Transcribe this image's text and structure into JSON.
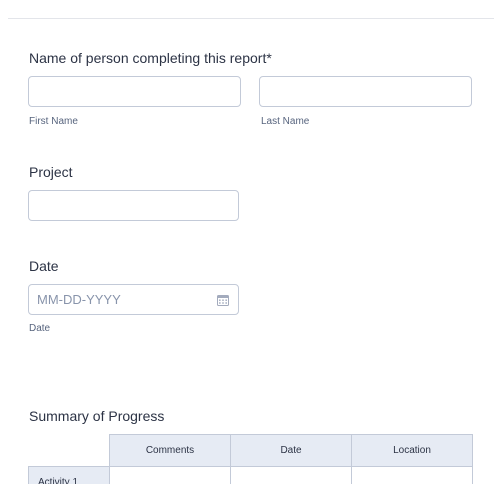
{
  "form": {
    "name_field": {
      "label": "Name of person completing this report*",
      "first_value": "",
      "last_value": "",
      "first_sublabel": "First Name",
      "last_sublabel": "Last Name"
    },
    "project_field": {
      "label": "Project",
      "value": ""
    },
    "date_field": {
      "label": "Date",
      "placeholder": "MM-DD-YYYY",
      "sublabel": "Date",
      "icon": "calendar-icon"
    },
    "summary": {
      "label": "Summary of Progress",
      "columns": [
        "Comments",
        "Date",
        "Location"
      ],
      "rows": [
        "Activity 1"
      ]
    }
  },
  "colors": {
    "border": "#c3cad8",
    "header_bg": "#e6ebf4",
    "text": "#2c3345",
    "sublabel": "#57647e",
    "placeholder": "#8894ab"
  }
}
